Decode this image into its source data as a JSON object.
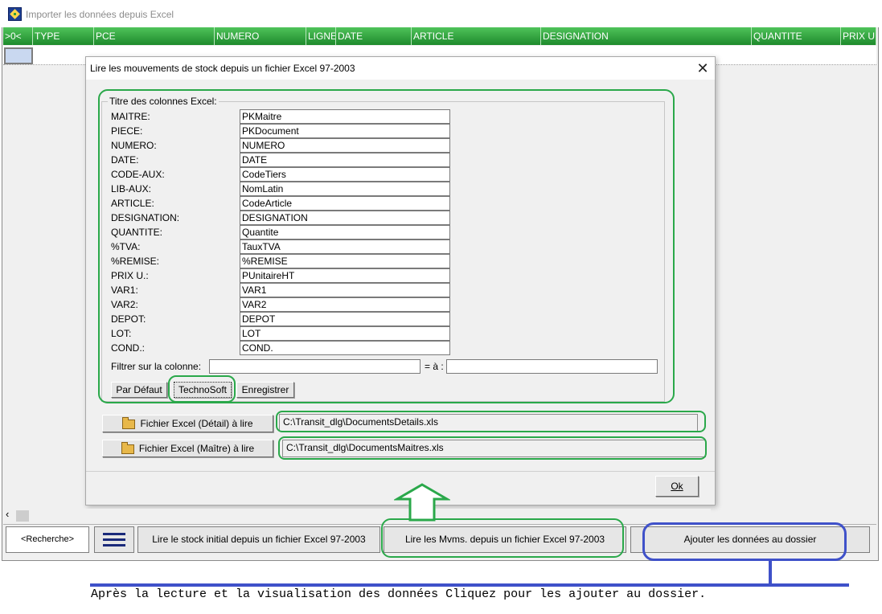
{
  "window": {
    "title": "Importer les données depuis Excel"
  },
  "grid": {
    "columns": [
      ">0<",
      "TYPE",
      "PCE",
      "NUMERO",
      "LIGNE",
      "DATE",
      "ARTICLE",
      "DESIGNATION",
      "QUANTITE",
      "PRIX U."
    ]
  },
  "dialog": {
    "title": "Lire les mouvements de stock depuis un fichier Excel 97-2003",
    "close_glyph": "✕",
    "group_label": "Titre des colonnes Excel:",
    "fields": [
      {
        "label": "MAITRE:",
        "value": "PKMaitre"
      },
      {
        "label": "PIECE:",
        "value": "PKDocument"
      },
      {
        "label": "NUMERO:",
        "value": "NUMERO"
      },
      {
        "label": "DATE:",
        "value": "DATE"
      },
      {
        "label": "CODE-AUX:",
        "value": "CodeTiers"
      },
      {
        "label": "LIB-AUX:",
        "value": "NomLatin"
      },
      {
        "label": "ARTICLE:",
        "value": "CodeArticle"
      },
      {
        "label": "DESIGNATION:",
        "value": "DESIGNATION"
      },
      {
        "label": "QUANTITE:",
        "value": "Quantite"
      },
      {
        "label": "%TVA:",
        "value": "TauxTVA"
      },
      {
        "label": "%REMISE:",
        "value": "%REMISE"
      },
      {
        "label": "PRIX U.:",
        "value": "PUnitaireHT"
      },
      {
        "label": "VAR1:",
        "value": "VAR1"
      },
      {
        "label": "VAR2:",
        "value": "VAR2"
      },
      {
        "label": "DEPOT:",
        "value": "DEPOT"
      },
      {
        "label": "LOT:",
        "value": "LOT"
      },
      {
        "label": "COND.:",
        "value": "COND."
      }
    ],
    "filter_label": "Filtrer sur la colonne:",
    "filter_value": "",
    "equals_label": "= à :",
    "equals_value": "",
    "btn_default": "Par Défaut",
    "btn_technosoft": "TechnoSoft",
    "btn_save": "Enregistrer",
    "btn_detail_file": "Fichier Excel (Détail) à lire",
    "detail_path": "C:\\Transit_dlg\\DocumentsDetails.xls",
    "btn_master_file": "Fichier Excel (Maître) à lire",
    "master_path": "C:\\Transit_dlg\\DocumentsMaitres.xls",
    "btn_ok": "Ok"
  },
  "bottom_bar": {
    "scroll_left": "‹",
    "search_label": "<Recherche>",
    "btn_read_initial": "Lire le stock initial depuis un fichier Excel 97-2003",
    "btn_read_mvms": "Lire les Mvms. depuis un fichier Excel 97-2003",
    "btn_add": "Ajouter les données au dossier"
  },
  "caption": "Après la lecture et la visualisation des données Cliquez pour les ajouter au dossier.",
  "colors": {
    "header_green": "#2aa040",
    "annotation_green": "#2aa84a",
    "annotation_blue": "#3f51c9"
  }
}
